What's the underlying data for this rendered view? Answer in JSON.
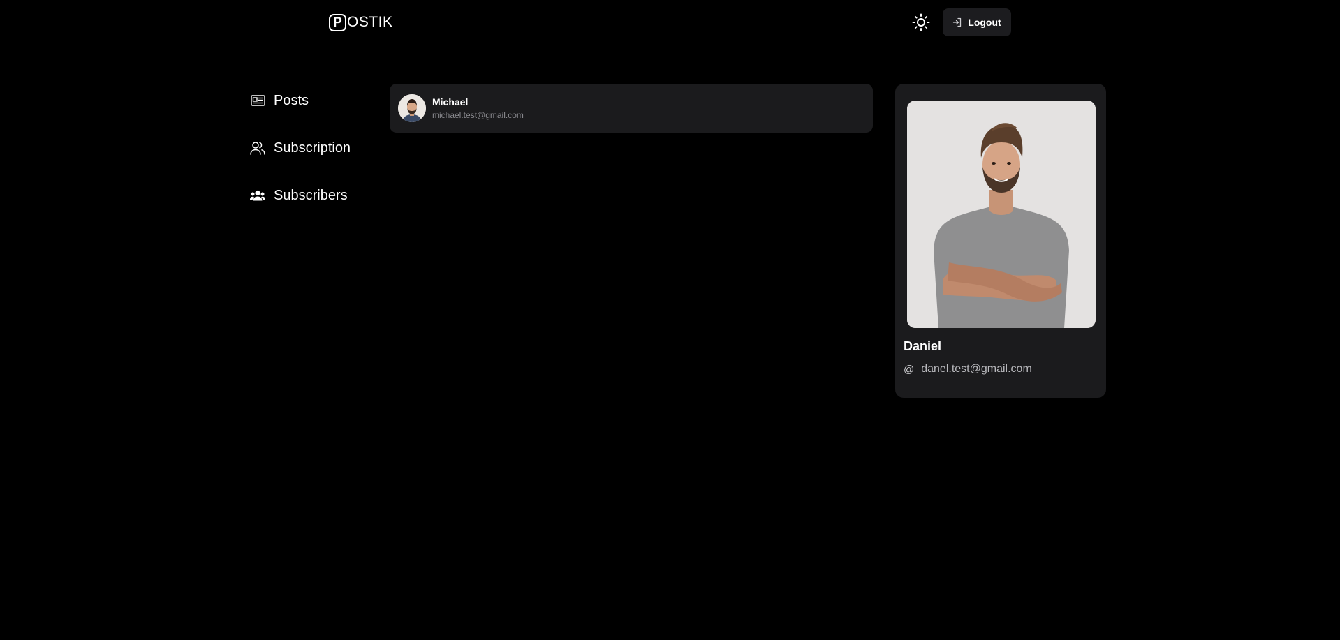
{
  "header": {
    "logo_letter": "P",
    "logo_text": "OSTIK",
    "theme_icon": "sun-icon",
    "logout_icon": "logout-icon",
    "logout_label": "Logout"
  },
  "sidebar": {
    "items": [
      {
        "label": "Posts",
        "icon": "newspaper-icon"
      },
      {
        "label": "Subscription",
        "icon": "users-outline-icon"
      },
      {
        "label": "Subscribers",
        "icon": "users-solid-icon"
      }
    ]
  },
  "subscribers": {
    "items": [
      {
        "name": "Michael",
        "email": "michael.test@gmail.com"
      }
    ]
  },
  "profile": {
    "name": "Daniel",
    "email": "danel.test@gmail.com",
    "email_icon": "at-icon"
  },
  "colors": {
    "background": "#000000",
    "card": "#1b1b1d",
    "button": "#1c1c1f",
    "muted_text": "#8a8a8f"
  }
}
